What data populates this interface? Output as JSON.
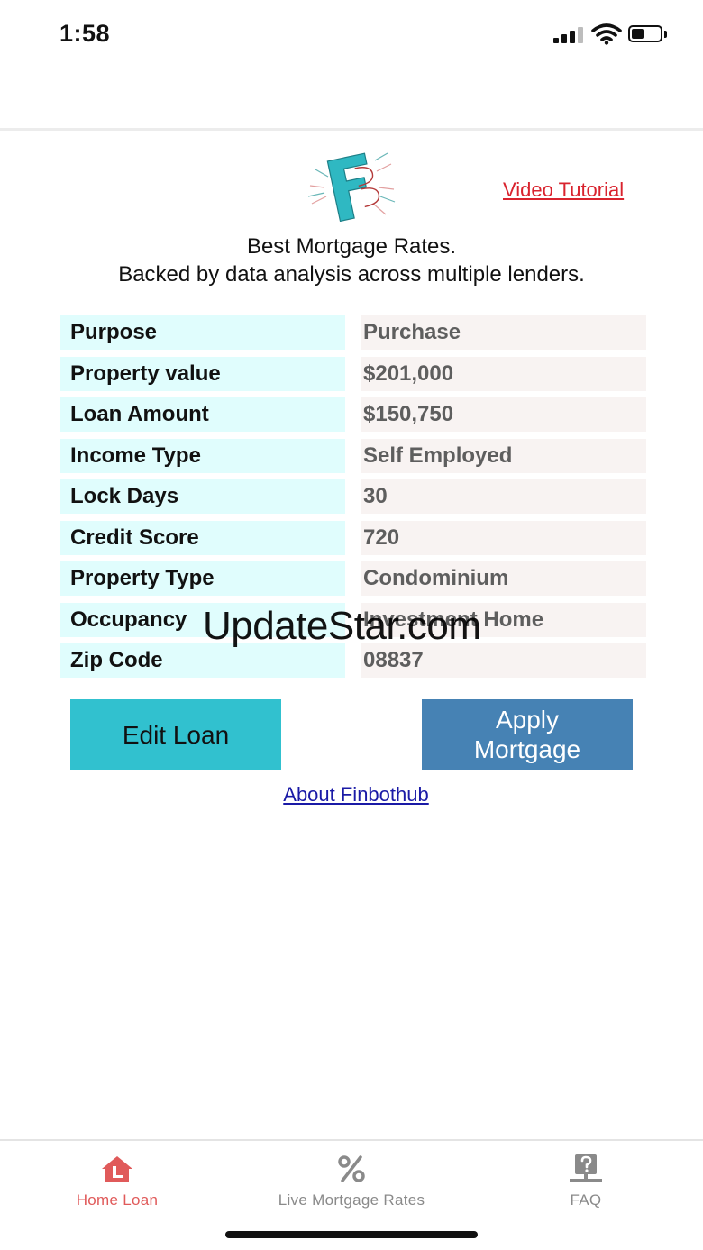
{
  "status_bar": {
    "time": "1:58"
  },
  "header": {
    "video_link": "Video Tutorial"
  },
  "tagline": {
    "line1": "Best Mortgage Rates.",
    "line2": "Backed by data analysis across multiple lenders."
  },
  "loan": {
    "rows": [
      {
        "label": "Purpose",
        "value": "Purchase"
      },
      {
        "label": "Property value",
        "value": "$201,000"
      },
      {
        "label": "Loan Amount",
        "value": "$150,750"
      },
      {
        "label": "Income Type",
        "value": "Self Employed"
      },
      {
        "label": "Lock Days",
        "value": "30"
      },
      {
        "label": "Credit Score",
        "value": "720"
      },
      {
        "label": "Property Type",
        "value": "Condominium"
      },
      {
        "label": "Occupancy",
        "value": "Investment Home"
      },
      {
        "label": "Zip Code",
        "value": "08837"
      }
    ]
  },
  "actions": {
    "edit_label": "Edit Loan",
    "apply_line1": "Apply",
    "apply_line2": "Mortgage",
    "about_label": "About Finbothub"
  },
  "watermark": "UpdateStar.com",
  "tabs": [
    {
      "label": "Home Loan",
      "icon": "home-loan-icon",
      "active": true
    },
    {
      "label": "Live Mortgage Rates",
      "icon": "percent-icon",
      "active": false
    },
    {
      "label": "FAQ",
      "icon": "faq-icon",
      "active": false
    }
  ],
  "colors": {
    "accent_active_tab": "#e05a5a",
    "video_link": "#d9232e",
    "edit_button": "#31c1cf",
    "apply_button": "#4682b4",
    "label_cell": "#e0fdfd",
    "value_cell": "#f8f3f2"
  }
}
